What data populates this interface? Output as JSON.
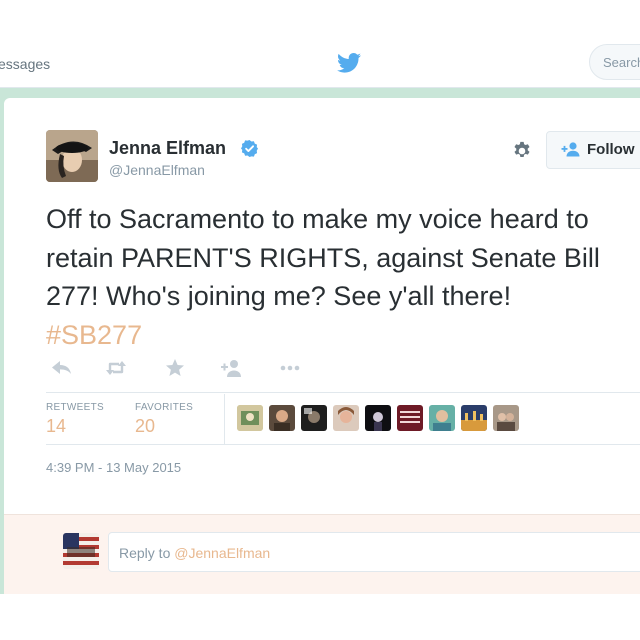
{
  "topbar": {
    "nav_label": "essages",
    "logo_icon": "twitter-bird-icon",
    "search_placeholder": "Search"
  },
  "tweet": {
    "author": {
      "name": "Jenna Elfman",
      "handle": "@JennaElfman",
      "verified": true
    },
    "follow_label": "Follow",
    "text_lines": [
      "Off to Sacramento to make my voice heard to",
      "retain PARENT'S RIGHTS, against Senate Bill",
      "277! Who's joining me? See y'all there!"
    ],
    "hashtag": "#SB277",
    "actions": [
      "reply-icon",
      "retweet-icon",
      "favorite-icon",
      "follow-user-icon",
      "more-icon"
    ],
    "stats": {
      "retweets_label": "RETWEETS",
      "retweets": "14",
      "favorites_label": "FAVORITES",
      "favorites": "20"
    },
    "favoriters_shown": 9,
    "timestamp": "4:39 PM - 13 May 2015"
  },
  "reply": {
    "prefix": "Reply to ",
    "mention": "@JennaElfman"
  },
  "colors": {
    "accent": "#e8b88f",
    "verified": "#55acee",
    "frame": "#c9e6d8",
    "text": "#292f33",
    "muted": "#8899a6"
  }
}
